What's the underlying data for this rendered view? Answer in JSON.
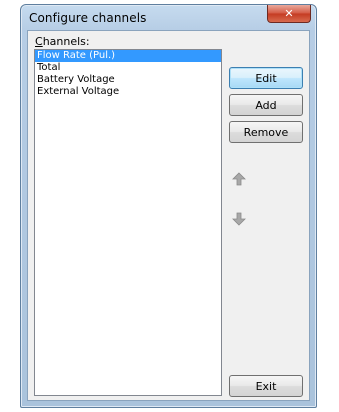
{
  "window": {
    "title": "Configure channels",
    "close_label": "✕"
  },
  "channels": {
    "label_accel": "C",
    "label_rest": "hannels:",
    "items": [
      {
        "label": "Flow Rate (Pul.)",
        "selected": true
      },
      {
        "label": "Total",
        "selected": false
      },
      {
        "label": "Battery Voltage",
        "selected": false
      },
      {
        "label": "External Voltage",
        "selected": false
      }
    ]
  },
  "buttons": {
    "edit": "Edit",
    "add": "Add",
    "remove": "Remove",
    "exit": "Exit"
  },
  "icons": {
    "move_up": "arrow-up-icon",
    "move_down": "arrow-down-icon"
  },
  "colors": {
    "selection": "#3399ff",
    "close_button": "#c43b22",
    "title_bar": "#b6cde5"
  }
}
